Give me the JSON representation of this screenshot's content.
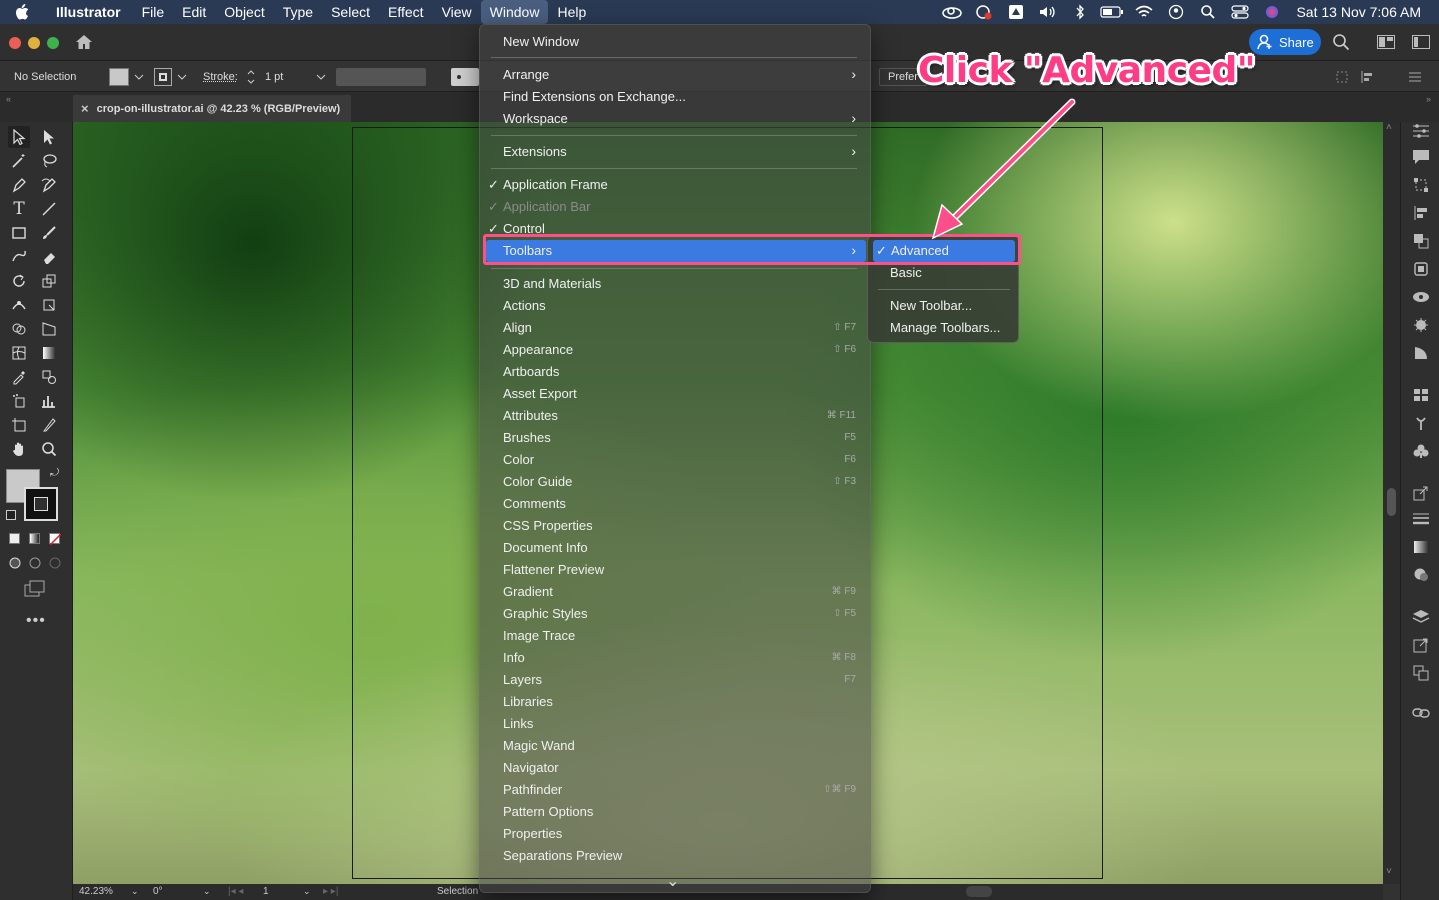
{
  "menubar": {
    "app_name": "Illustrator",
    "items": [
      "File",
      "Edit",
      "Object",
      "Type",
      "Select",
      "Effect",
      "View",
      "Window",
      "Help"
    ],
    "active_item": "Window",
    "clock": "Sat 13 Nov  7:06 AM",
    "status_icons": [
      "creative-cloud-icon",
      "screen-record-icon",
      "app-store-icon",
      "volume-icon",
      "bluetooth-icon",
      "battery-icon",
      "wifi-icon",
      "user-icon",
      "spotlight-icon",
      "control-center-icon",
      "siri-icon"
    ]
  },
  "appbar": {
    "share_label": "Share"
  },
  "control_bar": {
    "selection": "No Selection",
    "stroke_label": "Stroke:",
    "stroke_value": "1 pt",
    "prefs_label": "Prefer"
  },
  "document_tab": {
    "title": "crop-on-illustrator.ai @ 42.23 % (RGB/Preview)"
  },
  "status_bar": {
    "zoom": "42.23%",
    "rotation": "0°",
    "artboard_num": "1",
    "tool": "Selection"
  },
  "window_menu": {
    "group1": [
      {
        "label": "New Window"
      }
    ],
    "group2": [
      {
        "label": "Arrange",
        "submenu": true
      },
      {
        "label": "Find Extensions on Exchange..."
      },
      {
        "label": "Workspace",
        "submenu": true
      }
    ],
    "group3": [
      {
        "label": "Extensions",
        "submenu": true
      }
    ],
    "group4": [
      {
        "label": "Application Frame",
        "checked": true
      },
      {
        "label": "Application Bar",
        "checked": true,
        "disabled": true
      },
      {
        "label": "Control",
        "checked": true
      },
      {
        "label": "Toolbars",
        "submenu": true,
        "highlighted": true
      }
    ],
    "panels": [
      {
        "label": "3D and Materials",
        "shortcut": ""
      },
      {
        "label": "Actions",
        "shortcut": ""
      },
      {
        "label": "Align",
        "shortcut": "⇧ F7"
      },
      {
        "label": "Appearance",
        "shortcut": "⇧ F6"
      },
      {
        "label": "Artboards",
        "shortcut": ""
      },
      {
        "label": "Asset Export",
        "shortcut": ""
      },
      {
        "label": "Attributes",
        "shortcut": "⌘ F11"
      },
      {
        "label": "Brushes",
        "shortcut": "F5"
      },
      {
        "label": "Color",
        "shortcut": "F6"
      },
      {
        "label": "Color Guide",
        "shortcut": "⇧ F3"
      },
      {
        "label": "Comments",
        "shortcut": ""
      },
      {
        "label": "CSS Properties",
        "shortcut": ""
      },
      {
        "label": "Document Info",
        "shortcut": ""
      },
      {
        "label": "Flattener Preview",
        "shortcut": ""
      },
      {
        "label": "Gradient",
        "shortcut": "⌘ F9"
      },
      {
        "label": "Graphic Styles",
        "shortcut": "⇧ F5"
      },
      {
        "label": "Image Trace",
        "shortcut": ""
      },
      {
        "label": "Info",
        "shortcut": "⌘ F8"
      },
      {
        "label": "Layers",
        "shortcut": "F7"
      },
      {
        "label": "Libraries",
        "shortcut": ""
      },
      {
        "label": "Links",
        "shortcut": ""
      },
      {
        "label": "Magic Wand",
        "shortcut": ""
      },
      {
        "label": "Navigator",
        "shortcut": ""
      },
      {
        "label": "Pathfinder",
        "shortcut": "⇧⌘ F9"
      },
      {
        "label": "Pattern Options",
        "shortcut": ""
      },
      {
        "label": "Properties",
        "shortcut": ""
      },
      {
        "label": "Separations Preview",
        "shortcut": ""
      }
    ],
    "scroll_indicator": "⌄"
  },
  "toolbars_submenu": {
    "items": [
      {
        "label": "Advanced",
        "checked": true,
        "highlighted": true
      },
      {
        "label": "Basic"
      }
    ],
    "items2": [
      {
        "label": "New Toolbar..."
      },
      {
        "label": "Manage Toolbars..."
      }
    ]
  },
  "annotation": {
    "text": "Click \"Advanced\"",
    "color": "#ff3d86"
  },
  "colors": {
    "menubar_bg": "#2a3a54",
    "highlight": "#3b7ae0",
    "share_button": "#1d6fd6",
    "annotation_pink": "#ff4f8b"
  }
}
